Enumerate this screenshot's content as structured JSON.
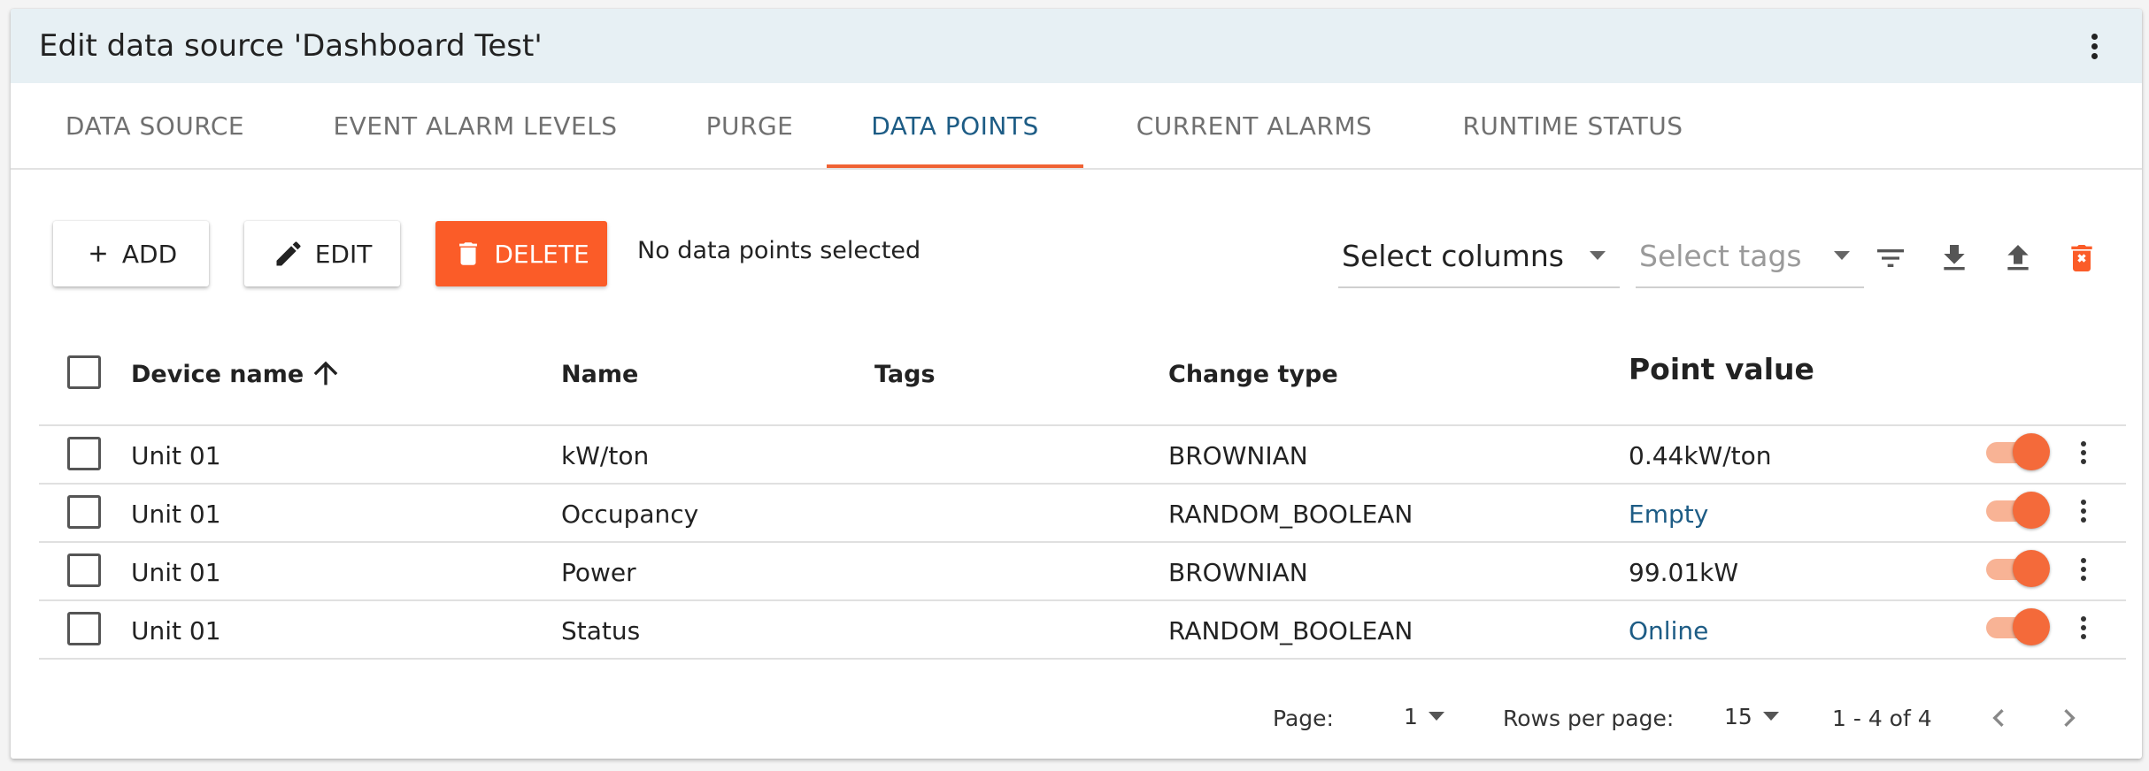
{
  "header": {
    "title": "Edit data source 'Dashboard Test'",
    "menu_icon": "more-vert-icon"
  },
  "tabs": [
    {
      "label": "DATA SOURCE",
      "active": false
    },
    {
      "label": "EVENT ALARM LEVELS",
      "active": false
    },
    {
      "label": "PURGE",
      "active": false
    },
    {
      "label": "DATA POINTS",
      "active": true
    },
    {
      "label": "CURRENT ALARMS",
      "active": false
    },
    {
      "label": "RUNTIME STATUS",
      "active": false
    }
  ],
  "toolbar": {
    "add_label": "ADD",
    "edit_label": "EDIT",
    "delete_label": "DELETE",
    "selection_status": "No data points selected",
    "select_columns": "Select columns",
    "select_tags": "Select tags",
    "icons": [
      "filter-icon",
      "download-icon",
      "upload-icon",
      "delete-all-icon"
    ]
  },
  "table": {
    "columns": [
      "Device name",
      "Name",
      "Tags",
      "Change type",
      "Point value"
    ],
    "sort_column": "Device name",
    "sort_direction": "ascending",
    "rows": [
      {
        "device": "Unit 01",
        "name": "kW/ton",
        "tags": "",
        "change_type": "BROWNIAN",
        "value": "0.44kW/ton",
        "value_style": "plain",
        "enabled": true
      },
      {
        "device": "Unit 01",
        "name": "Occupancy",
        "tags": "",
        "change_type": "RANDOM_BOOLEAN",
        "value": "Empty",
        "value_style": "link",
        "enabled": true
      },
      {
        "device": "Unit 01",
        "name": "Power",
        "tags": "",
        "change_type": "BROWNIAN",
        "value": "99.01kW",
        "value_style": "plain",
        "enabled": true
      },
      {
        "device": "Unit 01",
        "name": "Status",
        "tags": "",
        "change_type": "RANDOM_BOOLEAN",
        "value": "Online",
        "value_style": "link",
        "enabled": true
      }
    ]
  },
  "pagination": {
    "page_label": "Page:",
    "page": "1",
    "rows_per_page_label": "Rows per page:",
    "rows_per_page": "15",
    "range": "1 - 4 of 4"
  },
  "colors": {
    "accent": "#f06234",
    "delete": "#fb5c28",
    "link": "#1d5c85",
    "header_bg": "#e7f0f4"
  }
}
